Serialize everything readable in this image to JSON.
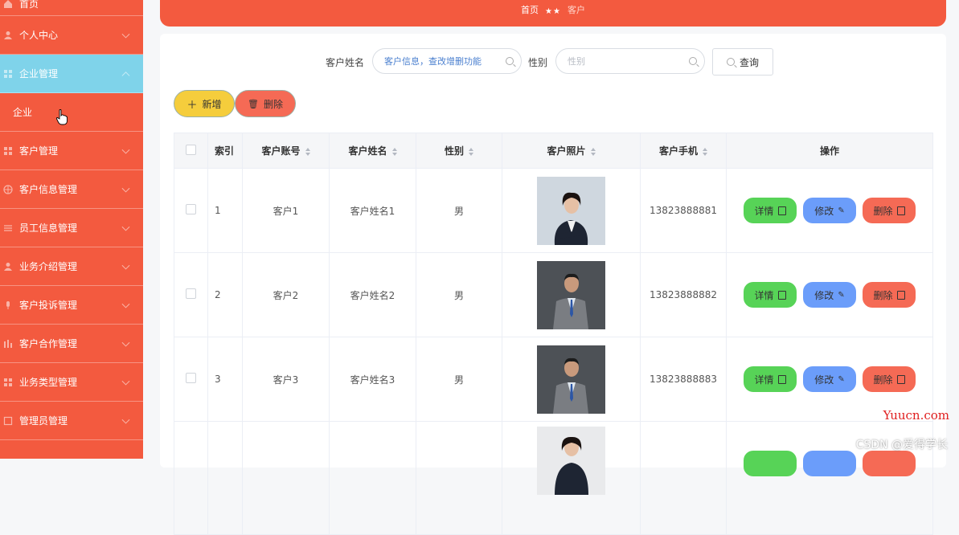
{
  "sidebar": {
    "items": [
      {
        "label": "首页",
        "icon": "home-icon"
      },
      {
        "label": "个人中心",
        "icon": "user-icon"
      },
      {
        "label": "企业管理",
        "icon": "grid-icon",
        "active": true
      },
      {
        "label": "企业",
        "sub": true
      },
      {
        "label": "客户管理",
        "icon": "grid-icon"
      },
      {
        "label": "客户信息管理",
        "icon": "globe-icon"
      },
      {
        "label": "员工信息管理",
        "icon": "sliders-icon"
      },
      {
        "label": "业务介绍管理",
        "icon": "user-icon"
      },
      {
        "label": "客户投诉管理",
        "icon": "mic-icon"
      },
      {
        "label": "客户合作管理",
        "icon": "bars-icon"
      },
      {
        "label": "业务类型管理",
        "icon": "grid-icon"
      },
      {
        "label": "管理员管理",
        "icon": "square-icon"
      }
    ]
  },
  "breadcrumb": {
    "home": "首页",
    "separator": "★★",
    "current": "客户"
  },
  "search": {
    "name_label": "客户姓名",
    "name_placeholder": "客户信息，查改增删功能",
    "gender_label": "性别",
    "gender_placeholder": "性别",
    "query_button": "查询"
  },
  "actions": {
    "add_label": "新增",
    "delete_label": "删除"
  },
  "table": {
    "columns": [
      "索引",
      "客户账号",
      "客户姓名",
      "性别",
      "客户照片",
      "客户手机",
      "操作"
    ],
    "rows": [
      {
        "index": "1",
        "account": "客户1",
        "name": "客户姓名1",
        "gender": "男",
        "phone": "13823888881"
      },
      {
        "index": "2",
        "account": "客户2",
        "name": "客户姓名2",
        "gender": "男",
        "phone": "13823888882"
      },
      {
        "index": "3",
        "account": "客户3",
        "name": "客户姓名3",
        "gender": "男",
        "phone": "13823888883"
      },
      {
        "index": "",
        "account": "",
        "name": "",
        "gender": "",
        "phone": ""
      }
    ],
    "row_buttons": {
      "detail": "详情",
      "edit": "修改",
      "remove": "删除"
    }
  },
  "watermarks": {
    "site": "Yuucn.com",
    "author": "CSDN @爱得学长"
  },
  "colors": {
    "sidebar": "#f35a3f",
    "active_menu": "#7fd3ea",
    "add_button": "#f5cd3c",
    "delete_button": "#f56a55",
    "detail_button": "#57d357",
    "edit_button": "#6b9dfa"
  }
}
